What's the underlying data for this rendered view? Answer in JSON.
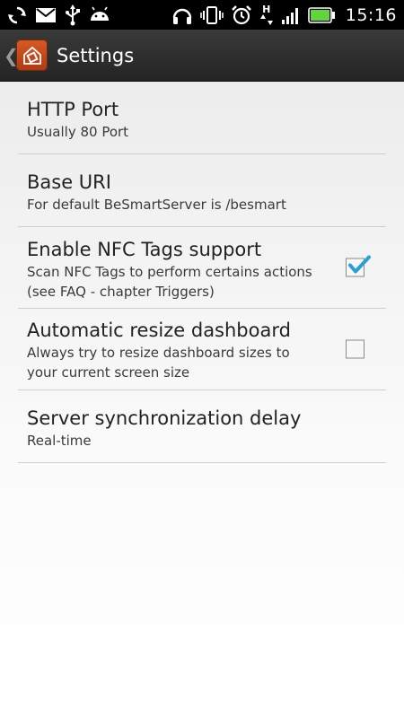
{
  "status_bar": {
    "time": "15:16",
    "left_icons": [
      "sync-icon",
      "gmail-icon",
      "usb-icon",
      "android-debug-icon"
    ],
    "right_icons": [
      "headset-icon",
      "vibrate-icon",
      "alarm-icon",
      "data-h-icon",
      "signal-icon",
      "battery-icon"
    ],
    "network_label": "H"
  },
  "action_bar": {
    "title": "Settings",
    "icon": "app-logo-icon"
  },
  "preferences": [
    {
      "title": "HTTP Port",
      "summary": "Usually 80 Port"
    },
    {
      "title": "Base URI",
      "summary": "For default BeSmartServer is /besmart"
    },
    {
      "title": "Enable NFC Tags support",
      "summary": "Scan NFC Tags to perform certains actions (see FAQ - chapter Triggers)",
      "checked": true
    },
    {
      "title": "Automatic resize dashboard",
      "summary": "Always try to resize dashboard sizes to your current screen size",
      "checked": false
    },
    {
      "title": "Server synchronization delay",
      "summary": "Real-time"
    }
  ],
  "colors": {
    "check_accent": "#2a9fd6",
    "battery_green": "#5fd63c",
    "app_icon": "#c9471a"
  }
}
